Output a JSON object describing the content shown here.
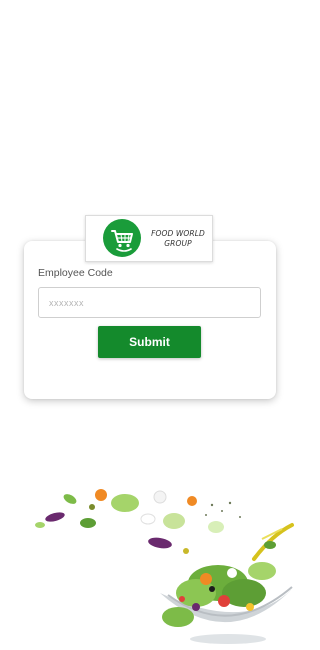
{
  "brand": {
    "name_line1": "FOOD WORLD",
    "name_line2": "GROUP",
    "logo_icon": "shopping-cart-smile-icon",
    "logo_color": "#1a9c3a"
  },
  "login_form": {
    "employee_code_label": "Employee Code",
    "employee_code_placeholder": "xxxxxxx",
    "employee_code_value": "",
    "submit_label": "Submit",
    "submit_color": "#148a2c"
  },
  "illustration": {
    "icon": "salad-bowl-illustration"
  }
}
